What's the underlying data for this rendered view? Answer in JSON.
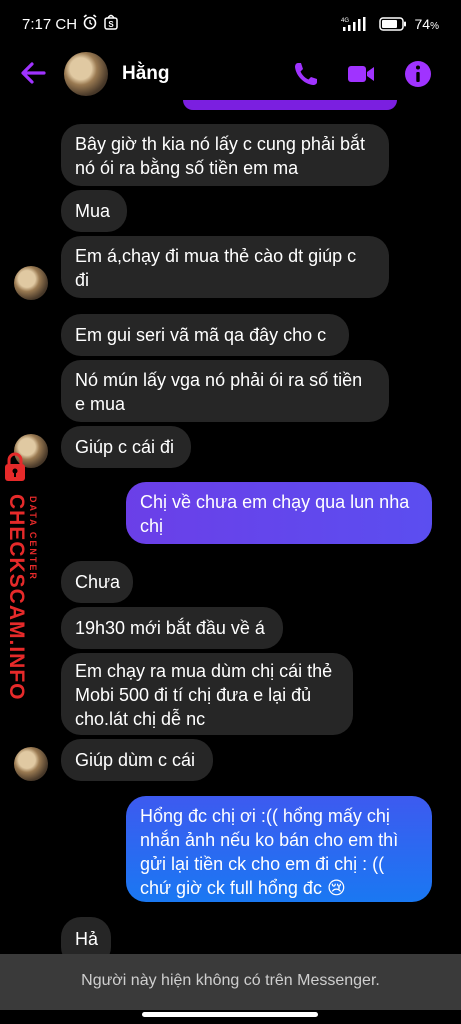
{
  "status_bar": {
    "time": "7:17 CH",
    "network": "4G",
    "battery": "74"
  },
  "header": {
    "contact_name": "Hằng"
  },
  "messages": [
    {
      "side": "received",
      "text": "Bây giờ th kia nó lấy c cung phải bắt nó ói ra bằng số tiền em ma"
    },
    {
      "side": "received",
      "text": "Mua"
    },
    {
      "side": "received",
      "text": "Em á,chạy đi mua thẻ cào dt giúp c đi"
    },
    {
      "side": "received",
      "text": "Em gui seri vã mã qa đây cho c"
    },
    {
      "side": "received",
      "text": "Nó mún lấy vga nó phải ói ra số tiền e mua"
    },
    {
      "side": "received",
      "text": "Giúp c cái đi"
    },
    {
      "side": "sent",
      "text": "Chị về chưa em chạy qua lun nha chị"
    },
    {
      "side": "received",
      "text": "Chưa"
    },
    {
      "side": "received",
      "text": "19h30 mới bắt đầu về á"
    },
    {
      "side": "received",
      "text": "Em chạy ra mua dùm chị cái thẻ Mobi 500 đi tí chị đưa e lại đủ cho.lát chị dễ nc"
    },
    {
      "side": "received",
      "text": "Giúp dùm c cái"
    },
    {
      "side": "sent",
      "text": "Hổng đc chị ơi :(( hổng mấy chị nhắn ảnh nếu ko bán cho em thì gửi lại tiền ck cho em đi chị : (( chứ giờ ck full hổng đc 😢"
    },
    {
      "side": "received",
      "text": "Hả"
    }
  ],
  "footer": {
    "notice": "Người này hiện không có trên Messenger."
  },
  "watermark": {
    "brand": "CHECKSCAM.INFO",
    "tagline": "DATA CENTER"
  },
  "colors": {
    "accent": "#a033ff",
    "sent_bubble_purple": "#5b45e6",
    "sent_bubble_blue": "#1877f2",
    "received_bubble": "#262626"
  }
}
